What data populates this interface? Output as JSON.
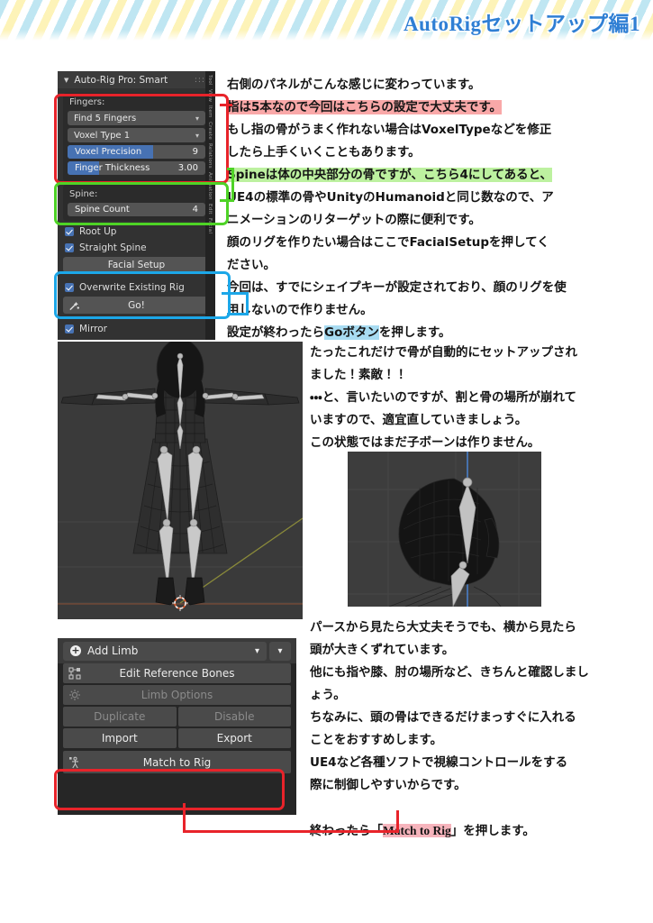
{
  "header": {
    "title": "AutoRigセットアップ編1",
    "title_color": "#2f7fd4"
  },
  "smart_panel": {
    "title": "Auto-Rig Pro: Smart",
    "collapse_icon": "triangle-down-icon",
    "grip_icon": "grip-dots-icon",
    "fingers_label": "Fingers:",
    "fingers_mode": "Find 5 Fingers",
    "voxel_type": "Voxel Type 1",
    "voxel_precision_label": "Voxel Precision",
    "voxel_precision_value": "9",
    "finger_thickness_label": "Finger Thickness",
    "finger_thickness_value": "3.00",
    "spine_label": "Spine:",
    "spine_count_label": "Spine Count",
    "spine_count_value": "4",
    "root_up_label": "Root Up",
    "straight_spine_label": "Straight Spine",
    "facial_setup_label": "Facial Setup",
    "overwrite_label": "Overwrite Existing Rig",
    "go_label": "Go!",
    "mirror_label": "Mirror",
    "side_tabs": [
      "Tool",
      "View",
      "Item",
      "Create",
      "Relations",
      "Animation",
      "Edit",
      "Facial"
    ]
  },
  "limb_panel": {
    "add_limb_label": "Add Limb",
    "add_icon": "plus-circle-icon",
    "dropdown_icon": "chevron-down-icon",
    "extra_dropdown_icon": "chevron-down-icon",
    "edit_reference_bones": "Edit Reference Bones",
    "edit_reference_icon": "bone-edit-icon",
    "limb_options": "Limb Options",
    "limb_options_icon": "gear-icon",
    "duplicate": "Duplicate",
    "disable": "Disable",
    "import": "Import",
    "export": "Export",
    "match_to_rig": "Match to Rig",
    "match_icon": "armature-icon"
  },
  "viewports": {
    "front": {
      "name": "front-orthographic-viewport",
      "description": "wireframe character in T-pose with auto-generated armature"
    },
    "side": {
      "name": "side-head-viewport",
      "description": "side view of head wireframe with offset head bone"
    }
  },
  "text_top": {
    "lines": [
      [
        {
          "t": "右側のパネルがこんな感じに変わっています。",
          "hl": ""
        }
      ],
      [
        {
          "t": "指は5本なので今回はこちらの設定で大丈夫です。",
          "hl": "hl-red"
        }
      ],
      [
        {
          "t": "もし指の骨がうまく作れない場合はVoxelTypeなどを修正",
          "hl": ""
        }
      ],
      [
        {
          "t": "したら上手くいくこともあります。",
          "hl": ""
        }
      ],
      [
        {
          "t": "Spineは体の中央部分の骨ですが、こちら4にしてあると、",
          "hl": "hl-green"
        }
      ],
      [
        {
          "t": "UE4の標準の骨やUnityのHumanoidと同じ数なので、ア",
          "hl": ""
        }
      ],
      [
        {
          "t": "ニメーションのリターゲットの際に便利です。",
          "hl": ""
        }
      ],
      [
        {
          "t": "顔のリグを作りたい場合はここでFacialSetupを押してく",
          "hl": ""
        }
      ],
      [
        {
          "t": "ださい。",
          "hl": ""
        }
      ],
      [
        {
          "t": "今回は、すでにシェイプキーが設定されており、顔のリグを使",
          "hl": ""
        }
      ],
      [
        {
          "t": "用しないので作りません。",
          "hl": ""
        }
      ],
      [
        {
          "t": "設定が終わったら",
          "hl": ""
        },
        {
          "t": "Goボタン",
          "hl": "hl-blue"
        },
        {
          "t": "を押します。",
          "hl": ""
        }
      ]
    ]
  },
  "text_mid": {
    "lines": [
      [
        {
          "t": "たったこれだけで骨が自動的にセットアップされ",
          "hl": ""
        }
      ],
      [
        {
          "t": "ました！素敵！！",
          "hl": ""
        }
      ],
      [
        {
          "t": "・・・と、言いたいのですが、割と骨の場所が崩れて",
          "hl": ""
        }
      ],
      [
        {
          "t": "いますので、適宜直していきましょう。",
          "hl": ""
        }
      ],
      [
        {
          "t": "この状態ではまだ子ボーンは作りません。",
          "hl": ""
        }
      ]
    ]
  },
  "text_bot": {
    "lines": [
      [
        {
          "t": "パースから見たら大丈夫そうでも、横から見たら",
          "hl": ""
        }
      ],
      [
        {
          "t": "頭が大きくずれています。",
          "hl": ""
        }
      ],
      [
        {
          "t": "他にも指や膝、肘の場所など、きちんと確認しまし",
          "hl": ""
        }
      ],
      [
        {
          "t": "ょう。",
          "hl": ""
        }
      ],
      [
        {
          "t": "ちなみに、頭の骨はできるだけまっすぐに入れる",
          "hl": ""
        }
      ],
      [
        {
          "t": "ことをおすすめします。",
          "hl": ""
        }
      ],
      [
        {
          "t": "UE4など各種ソフトで視線コントロールをする",
          "hl": ""
        }
      ],
      [
        {
          "t": "際に制御しやすいからです。",
          "hl": ""
        }
      ],
      [
        {
          "t": "",
          "hl": ""
        }
      ],
      [
        {
          "t": "終わったら「",
          "hl": ""
        },
        {
          "t": "Match to Rig",
          "hl": "hl-pink",
          "serif": true
        },
        {
          "t": "」を押します。",
          "hl": ""
        }
      ]
    ]
  },
  "annotations": {
    "fingers_box_color": "#e8232a",
    "spine_box_color": "#4ed326",
    "go_box_color": "#1ca7e8",
    "match_box_color": "#e8232a"
  }
}
